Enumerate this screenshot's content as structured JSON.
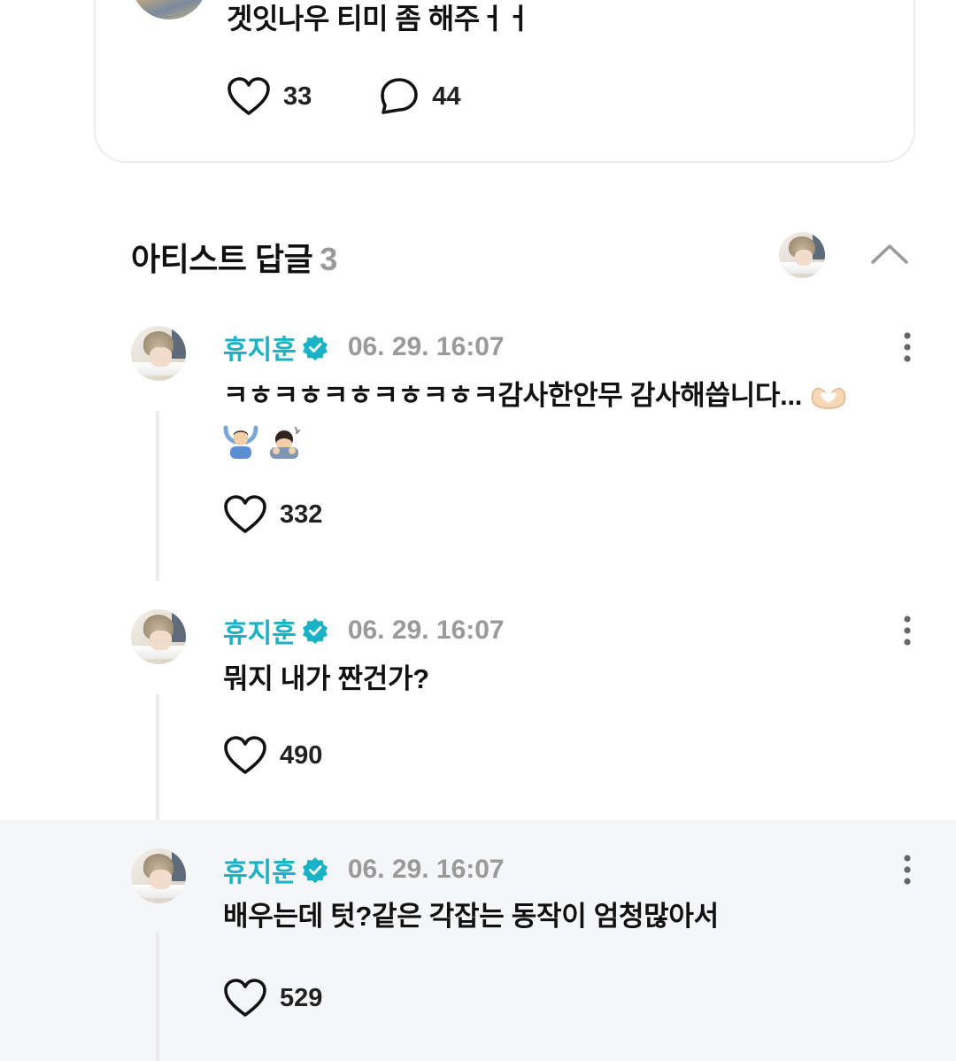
{
  "post": {
    "text": "겟잇나우 티미 좀 해주ㅓㅓ",
    "likes": "33",
    "comments": "44"
  },
  "section": {
    "title": "아티스트 답글",
    "count": "3"
  },
  "replies": [
    {
      "name": "휴지훈",
      "time": "06. 29. 16:07",
      "text": "ㅋㅎㅋㅎㅋㅎㅋㅎㅋㅎㅋ감사한안무 감사해씁니다...",
      "likes": "332",
      "emojis": [
        "heart-hands-emoji",
        "person-gesturing-ok-emoji",
        "man-bowing-emoji"
      ]
    },
    {
      "name": "휴지훈",
      "time": "06. 29. 16:07",
      "text": "뭐지 내가 짠건가?",
      "likes": "490"
    },
    {
      "name": "휴지훈",
      "time": "06. 29. 16:07",
      "text": "배우는데 텃?같은 각잡는 동작이 엄청많아서",
      "likes": "529"
    }
  ],
  "colors": {
    "artist_name": "#1ab2c6",
    "verified": "#1ab2c6",
    "muted": "#9a9a9a",
    "highlight_bg": "#f5f6f8"
  }
}
